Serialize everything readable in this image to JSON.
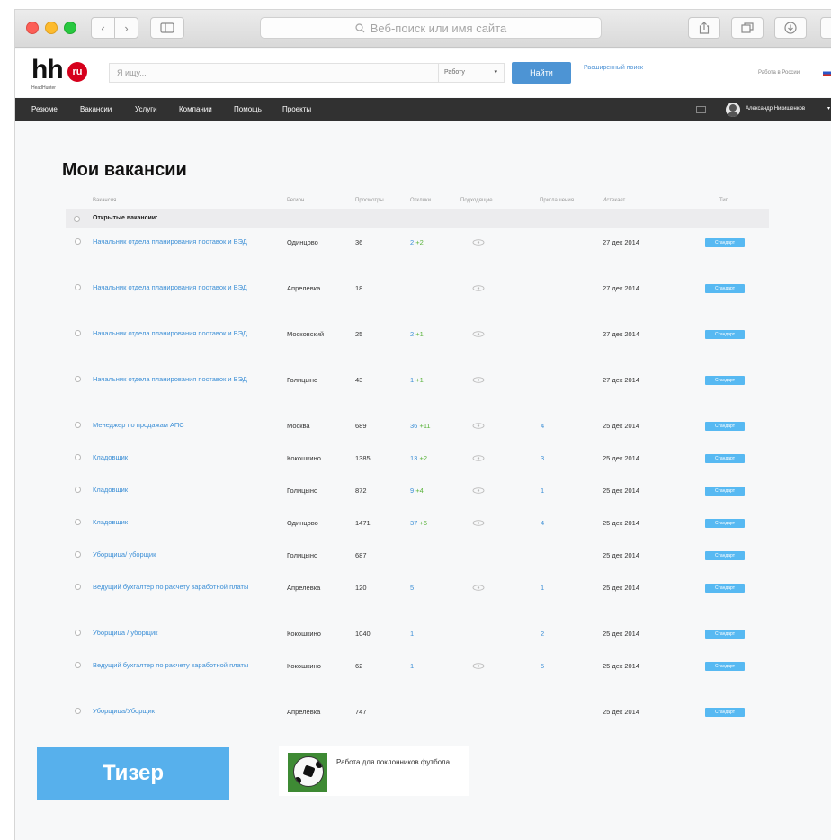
{
  "browser": {
    "address_placeholder": "Веб-поиск или имя сайта"
  },
  "header": {
    "logo": {
      "main": "hh",
      "badge": "ru",
      "sub": "HeadHunter"
    },
    "search_placeholder": "Я ищу...",
    "search_type": "Работу",
    "find_button": "Найти",
    "advanced_search": "Расширенный поиск",
    "region": "Работа в России"
  },
  "nav": {
    "items": [
      "Резюме",
      "Вакансии",
      "Услуги",
      "Компании",
      "Помощь",
      "Проекты"
    ],
    "user_name": "Александр Никишенков"
  },
  "page": {
    "title": "Мои вакансии",
    "columns": [
      "Вакансия",
      "Регион",
      "Просмотры",
      "Отклики",
      "Подходящие",
      "Приглашения",
      "Истекает",
      "Тип"
    ],
    "group_label": "Открытые вакансии:",
    "badge_label": "Стандарт"
  },
  "vacancies": [
    {
      "title": "Начальник отдела планирования поставок и ВЭД",
      "region": "Одинцово",
      "views": "36",
      "responses": "2",
      "new": "+2",
      "subscribed": true,
      "invites": "",
      "expires": "27 дек 2014"
    },
    {
      "title": "Начальник отдела планирования поставок и ВЭД",
      "region": "Апрелевка",
      "views": "18",
      "responses": "",
      "new": "",
      "subscribed": true,
      "invites": "",
      "expires": "27 дек 2014"
    },
    {
      "title": "Начальник отдела планирования поставок и ВЭД",
      "region": "Московский",
      "views": "25",
      "responses": "2",
      "new": "+1",
      "subscribed": true,
      "invites": "",
      "expires": "27 дек 2014"
    },
    {
      "title": "Начальник отдела планирования поставок и ВЭД",
      "region": "Голицыно",
      "views": "43",
      "responses": "1",
      "new": "+1",
      "subscribed": true,
      "invites": "",
      "expires": "27 дек 2014"
    },
    {
      "title": "Менеджер по продажам АПС",
      "region": "Москва",
      "views": "689",
      "responses": "36",
      "new": "+11",
      "subscribed": true,
      "invites": "4",
      "expires": "25 дек 2014"
    },
    {
      "title": "Кладовщик",
      "region": "Кокошкино",
      "views": "1385",
      "responses": "13",
      "new": "+2",
      "subscribed": true,
      "invites": "3",
      "expires": "25 дек 2014"
    },
    {
      "title": "Кладовщик",
      "region": "Голицыно",
      "views": "872",
      "responses": "9",
      "new": "+4",
      "subscribed": true,
      "invites": "1",
      "expires": "25 дек 2014"
    },
    {
      "title": "Кладовщик",
      "region": "Одинцово",
      "views": "1471",
      "responses": "37",
      "new": "+6",
      "subscribed": true,
      "invites": "4",
      "expires": "25 дек 2014"
    },
    {
      "title": "Уборщица/ уборщик",
      "region": "Голицыно",
      "views": "687",
      "responses": "",
      "new": "",
      "subscribed": false,
      "invites": "",
      "expires": "25 дек 2014"
    },
    {
      "title": "Ведущий бухгалтер по расчету заработной платы",
      "region": "Апрелевка",
      "views": "120",
      "responses": "5",
      "new": "",
      "subscribed": true,
      "invites": "1",
      "expires": "25 дек 2014"
    },
    {
      "title": "Уборщица / уборщик",
      "region": "Кокошкино",
      "views": "1040",
      "responses": "1",
      "new": "",
      "subscribed": false,
      "invites": "2",
      "expires": "25 дек 2014"
    },
    {
      "title": "Ведущий бухгалтер по расчету заработной платы",
      "region": "Кокошкино",
      "views": "62",
      "responses": "1",
      "new": "",
      "subscribed": true,
      "invites": "5",
      "expires": "25 дек 2014"
    },
    {
      "title": "Уборщица/Уборщик",
      "region": "Апрелевка",
      "views": "747",
      "responses": "",
      "new": "",
      "subscribed": false,
      "invites": "",
      "expires": "25 дек 2014"
    }
  ],
  "teaser": {
    "button": "Тизер",
    "text": "Работа для поклонников футбола"
  },
  "colors": {
    "link": "#3c8fd6",
    "new_responses": "#5ab33c",
    "nav_bg": "#313131",
    "primary_button": "#4d94d4",
    "badge": "#57b9f2",
    "teaser": "#57b0ec",
    "logo_badge": "#d6001c"
  }
}
